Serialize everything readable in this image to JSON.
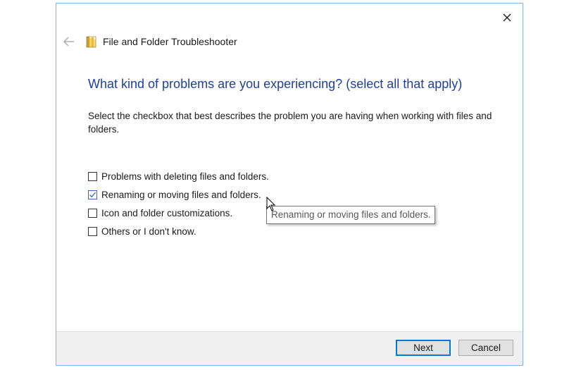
{
  "header": {
    "title": "File and Folder Troubleshooter",
    "back_icon": "back-arrow-icon",
    "app_icon": "folder-icon",
    "close_icon": "close-icon"
  },
  "main": {
    "heading": "What kind of problems are you experiencing? (select all that apply)",
    "description": "Select the checkbox that best describes the problem you are having when working with files and folders."
  },
  "options": [
    {
      "label": "Problems with deleting files and folders.",
      "checked": false
    },
    {
      "label": "Renaming or moving files and folders.",
      "checked": true
    },
    {
      "label": "Icon and folder customizations.",
      "checked": false
    },
    {
      "label": "Others or I don't know.",
      "checked": false
    }
  ],
  "tooltip": {
    "text": "Renaming or moving files and folders."
  },
  "footer": {
    "next_label": "Next",
    "cancel_label": "Cancel"
  },
  "colors": {
    "heading": "#1f3fa0",
    "accent": "#0078d7",
    "footer_bg": "#f0f0f0"
  }
}
